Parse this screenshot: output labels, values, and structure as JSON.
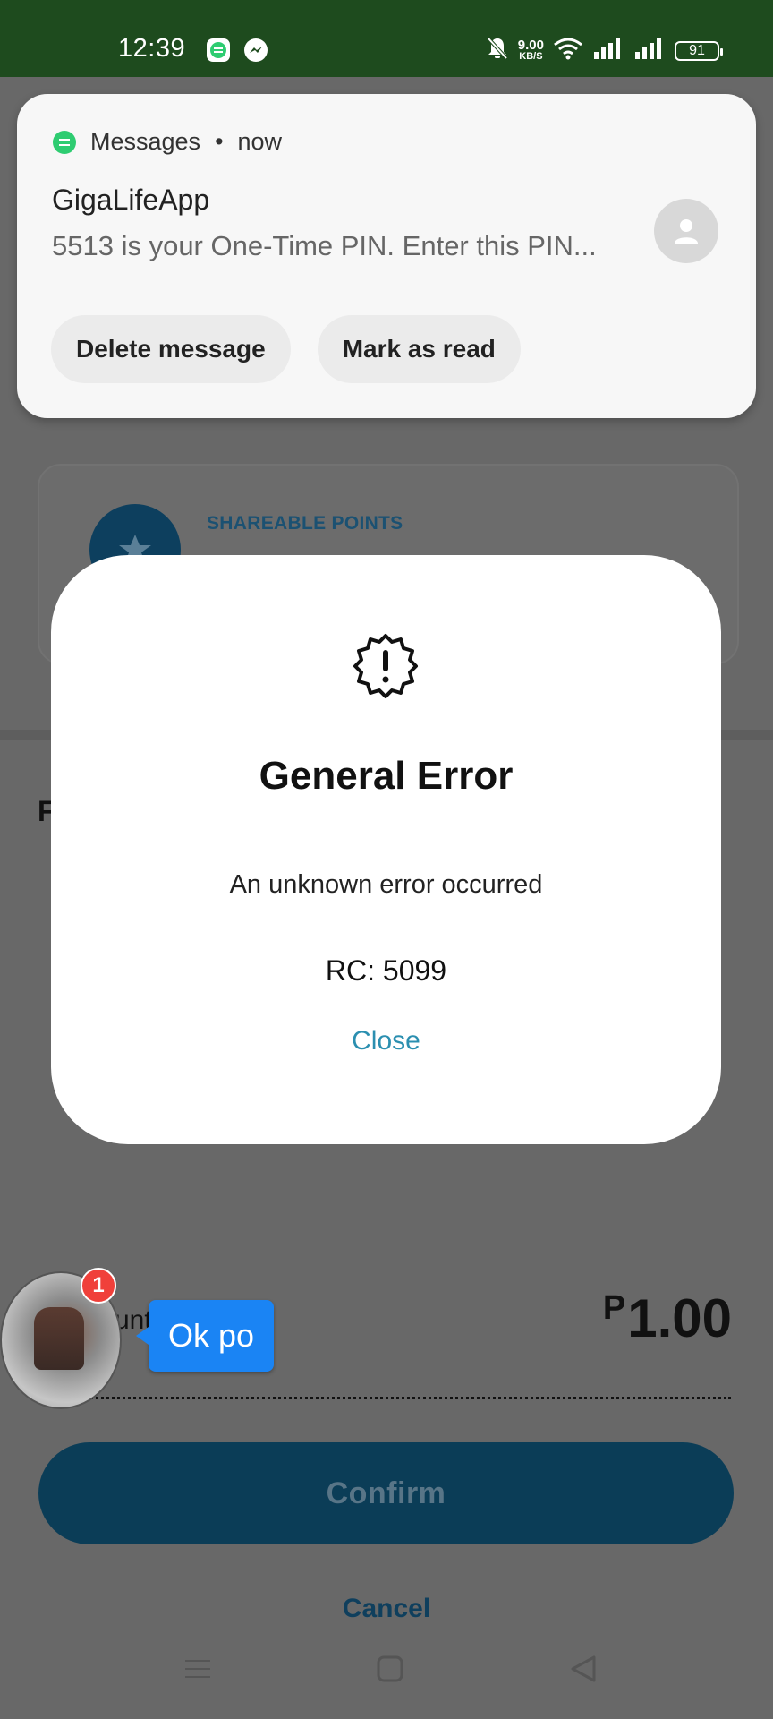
{
  "status_bar": {
    "time": "12:39",
    "net_speed_value": "9.00",
    "net_speed_unit": "KB/S",
    "battery": "91"
  },
  "notification": {
    "app_name": "Messages",
    "separator": "•",
    "time": "now",
    "title": "GigaLifeApp",
    "body": "5513 is your One-Time PIN. Enter this PIN...",
    "actions": [
      "Delete message",
      "Mark as read"
    ]
  },
  "background": {
    "card_label": "SHAREABLE POINTS",
    "partial_letter": "F",
    "amount_label_partial": "unt",
    "currency_symbol": "P",
    "amount": "1.00",
    "confirm_label": "Confirm",
    "cancel_label": "Cancel"
  },
  "chat_head": {
    "badge_count": "1",
    "message": "Ok po"
  },
  "dialog": {
    "title": "General Error",
    "message": "An unknown error occurred",
    "code": "RC: 5099",
    "close_label": "Close"
  },
  "icons": {
    "error": "alert-badge-icon",
    "star": "star-icon",
    "avatar": "person-icon",
    "messenger": "messenger-icon",
    "messages": "message-icon"
  },
  "colors": {
    "status_bar_bg": "#1e4b1e",
    "confirm_bg": "#0b3d57",
    "close_link": "#2b8fb0",
    "chat_bubble": "#1a84f4",
    "badge": "#f0403a"
  }
}
